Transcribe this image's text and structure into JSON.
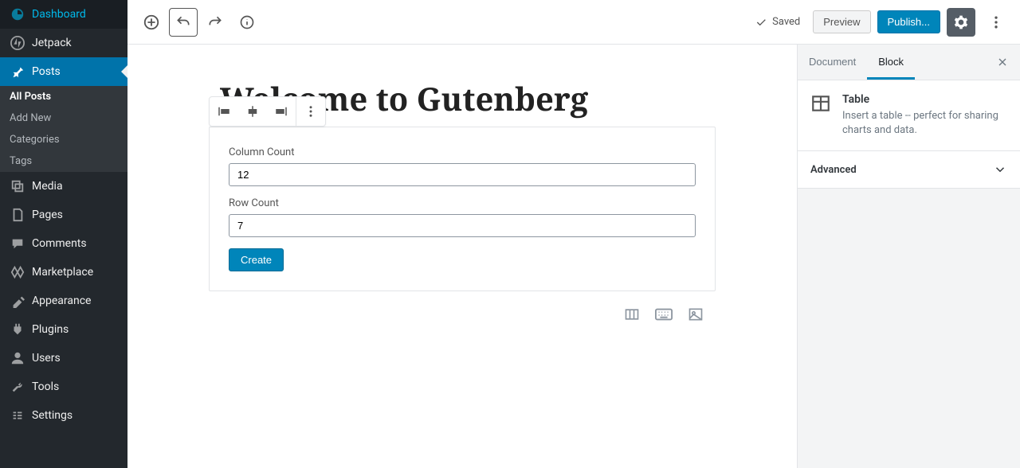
{
  "sidebar": {
    "items": [
      {
        "id": "dashboard",
        "label": "Dashboard"
      },
      {
        "id": "jetpack",
        "label": "Jetpack"
      },
      {
        "id": "posts",
        "label": "Posts"
      },
      {
        "id": "media",
        "label": "Media"
      },
      {
        "id": "pages",
        "label": "Pages"
      },
      {
        "id": "comments",
        "label": "Comments"
      },
      {
        "id": "marketplace",
        "label": "Marketplace"
      },
      {
        "id": "appearance",
        "label": "Appearance"
      },
      {
        "id": "plugins",
        "label": "Plugins"
      },
      {
        "id": "users",
        "label": "Users"
      },
      {
        "id": "tools",
        "label": "Tools"
      },
      {
        "id": "settings",
        "label": "Settings"
      }
    ],
    "posts_sub": [
      {
        "id": "all",
        "label": "All Posts"
      },
      {
        "id": "add",
        "label": "Add New"
      },
      {
        "id": "cat",
        "label": "Categories"
      },
      {
        "id": "tags",
        "label": "Tags"
      }
    ]
  },
  "topbar": {
    "saved_label": "Saved",
    "preview_label": "Preview",
    "publish_label": "Publish..."
  },
  "editor": {
    "title": "Welcome to Gutenberg",
    "table_form": {
      "col_label": "Column Count",
      "col_value": "12",
      "row_label": "Row Count",
      "row_value": "7",
      "create_label": "Create"
    }
  },
  "settings": {
    "tab_document": "Document",
    "tab_block": "Block",
    "block_card": {
      "title": "Table",
      "desc": "Insert a table -- perfect for sharing charts and data."
    },
    "advanced_label": "Advanced"
  }
}
